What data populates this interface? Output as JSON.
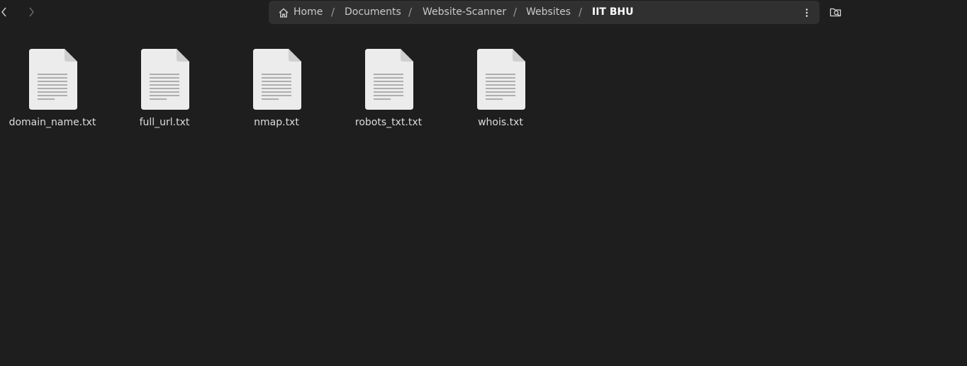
{
  "window": {
    "background": "#1e1e1e"
  },
  "pathbar": {
    "crumbs": [
      {
        "label": "Home",
        "icon": "home-icon"
      },
      {
        "label": "Documents"
      },
      {
        "label": "Website-Scanner"
      },
      {
        "label": "Websites"
      },
      {
        "label": "IIT BHU",
        "current": true
      }
    ],
    "separator": "/",
    "menu_icon": "vertical-ellipsis-icon"
  },
  "search": {
    "icon": "search-folder-icon"
  },
  "files": [
    {
      "name": "domain_name.txt",
      "icon": "text-document-icon"
    },
    {
      "name": "full_url.txt",
      "icon": "text-document-icon"
    },
    {
      "name": "nmap.txt",
      "icon": "text-document-icon"
    },
    {
      "name": "robots_txt.txt",
      "icon": "text-document-icon"
    },
    {
      "name": "whois.txt",
      "icon": "text-document-icon"
    }
  ]
}
